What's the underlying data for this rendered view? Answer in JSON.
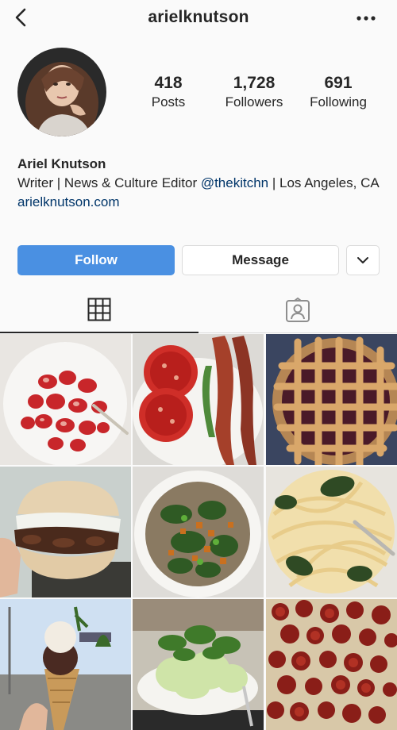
{
  "header": {
    "username": "arielknutson",
    "back_icon": "chevron-left-icon",
    "more_icon": "more-horizontal-icon"
  },
  "profile": {
    "stats": {
      "posts_count": "418",
      "posts_label": "Posts",
      "followers_count": "1,728",
      "followers_label": "Followers",
      "following_count": "691",
      "following_label": "Following"
    },
    "name": "Ariel Knutson",
    "bio_prefix": "Writer | News & Culture Editor ",
    "bio_mention": "@thekitchn",
    "bio_suffix": " | Los Angeles, CA",
    "website": "arielknutson.com"
  },
  "actions": {
    "follow_label": "Follow",
    "message_label": "Message",
    "dropdown_icon": "chevron-down-icon"
  },
  "tabs": {
    "grid_icon": "grid-icon",
    "tagged_icon": "tagged-user-icon"
  },
  "colors": {
    "follow_button": "#4a90e2",
    "link": "#003569",
    "text": "#262626",
    "background": "#fafafa"
  },
  "posts": [
    {
      "subject": "strawberries"
    },
    {
      "subject": "tomato-bacon-sandwich"
    },
    {
      "subject": "lattice-pie"
    },
    {
      "subject": "mushroom-sandwich"
    },
    {
      "subject": "greens-bowl"
    },
    {
      "subject": "pasta"
    },
    {
      "subject": "ice-cream-cone"
    },
    {
      "subject": "salad"
    },
    {
      "subject": "pepperoni-pizza"
    }
  ]
}
